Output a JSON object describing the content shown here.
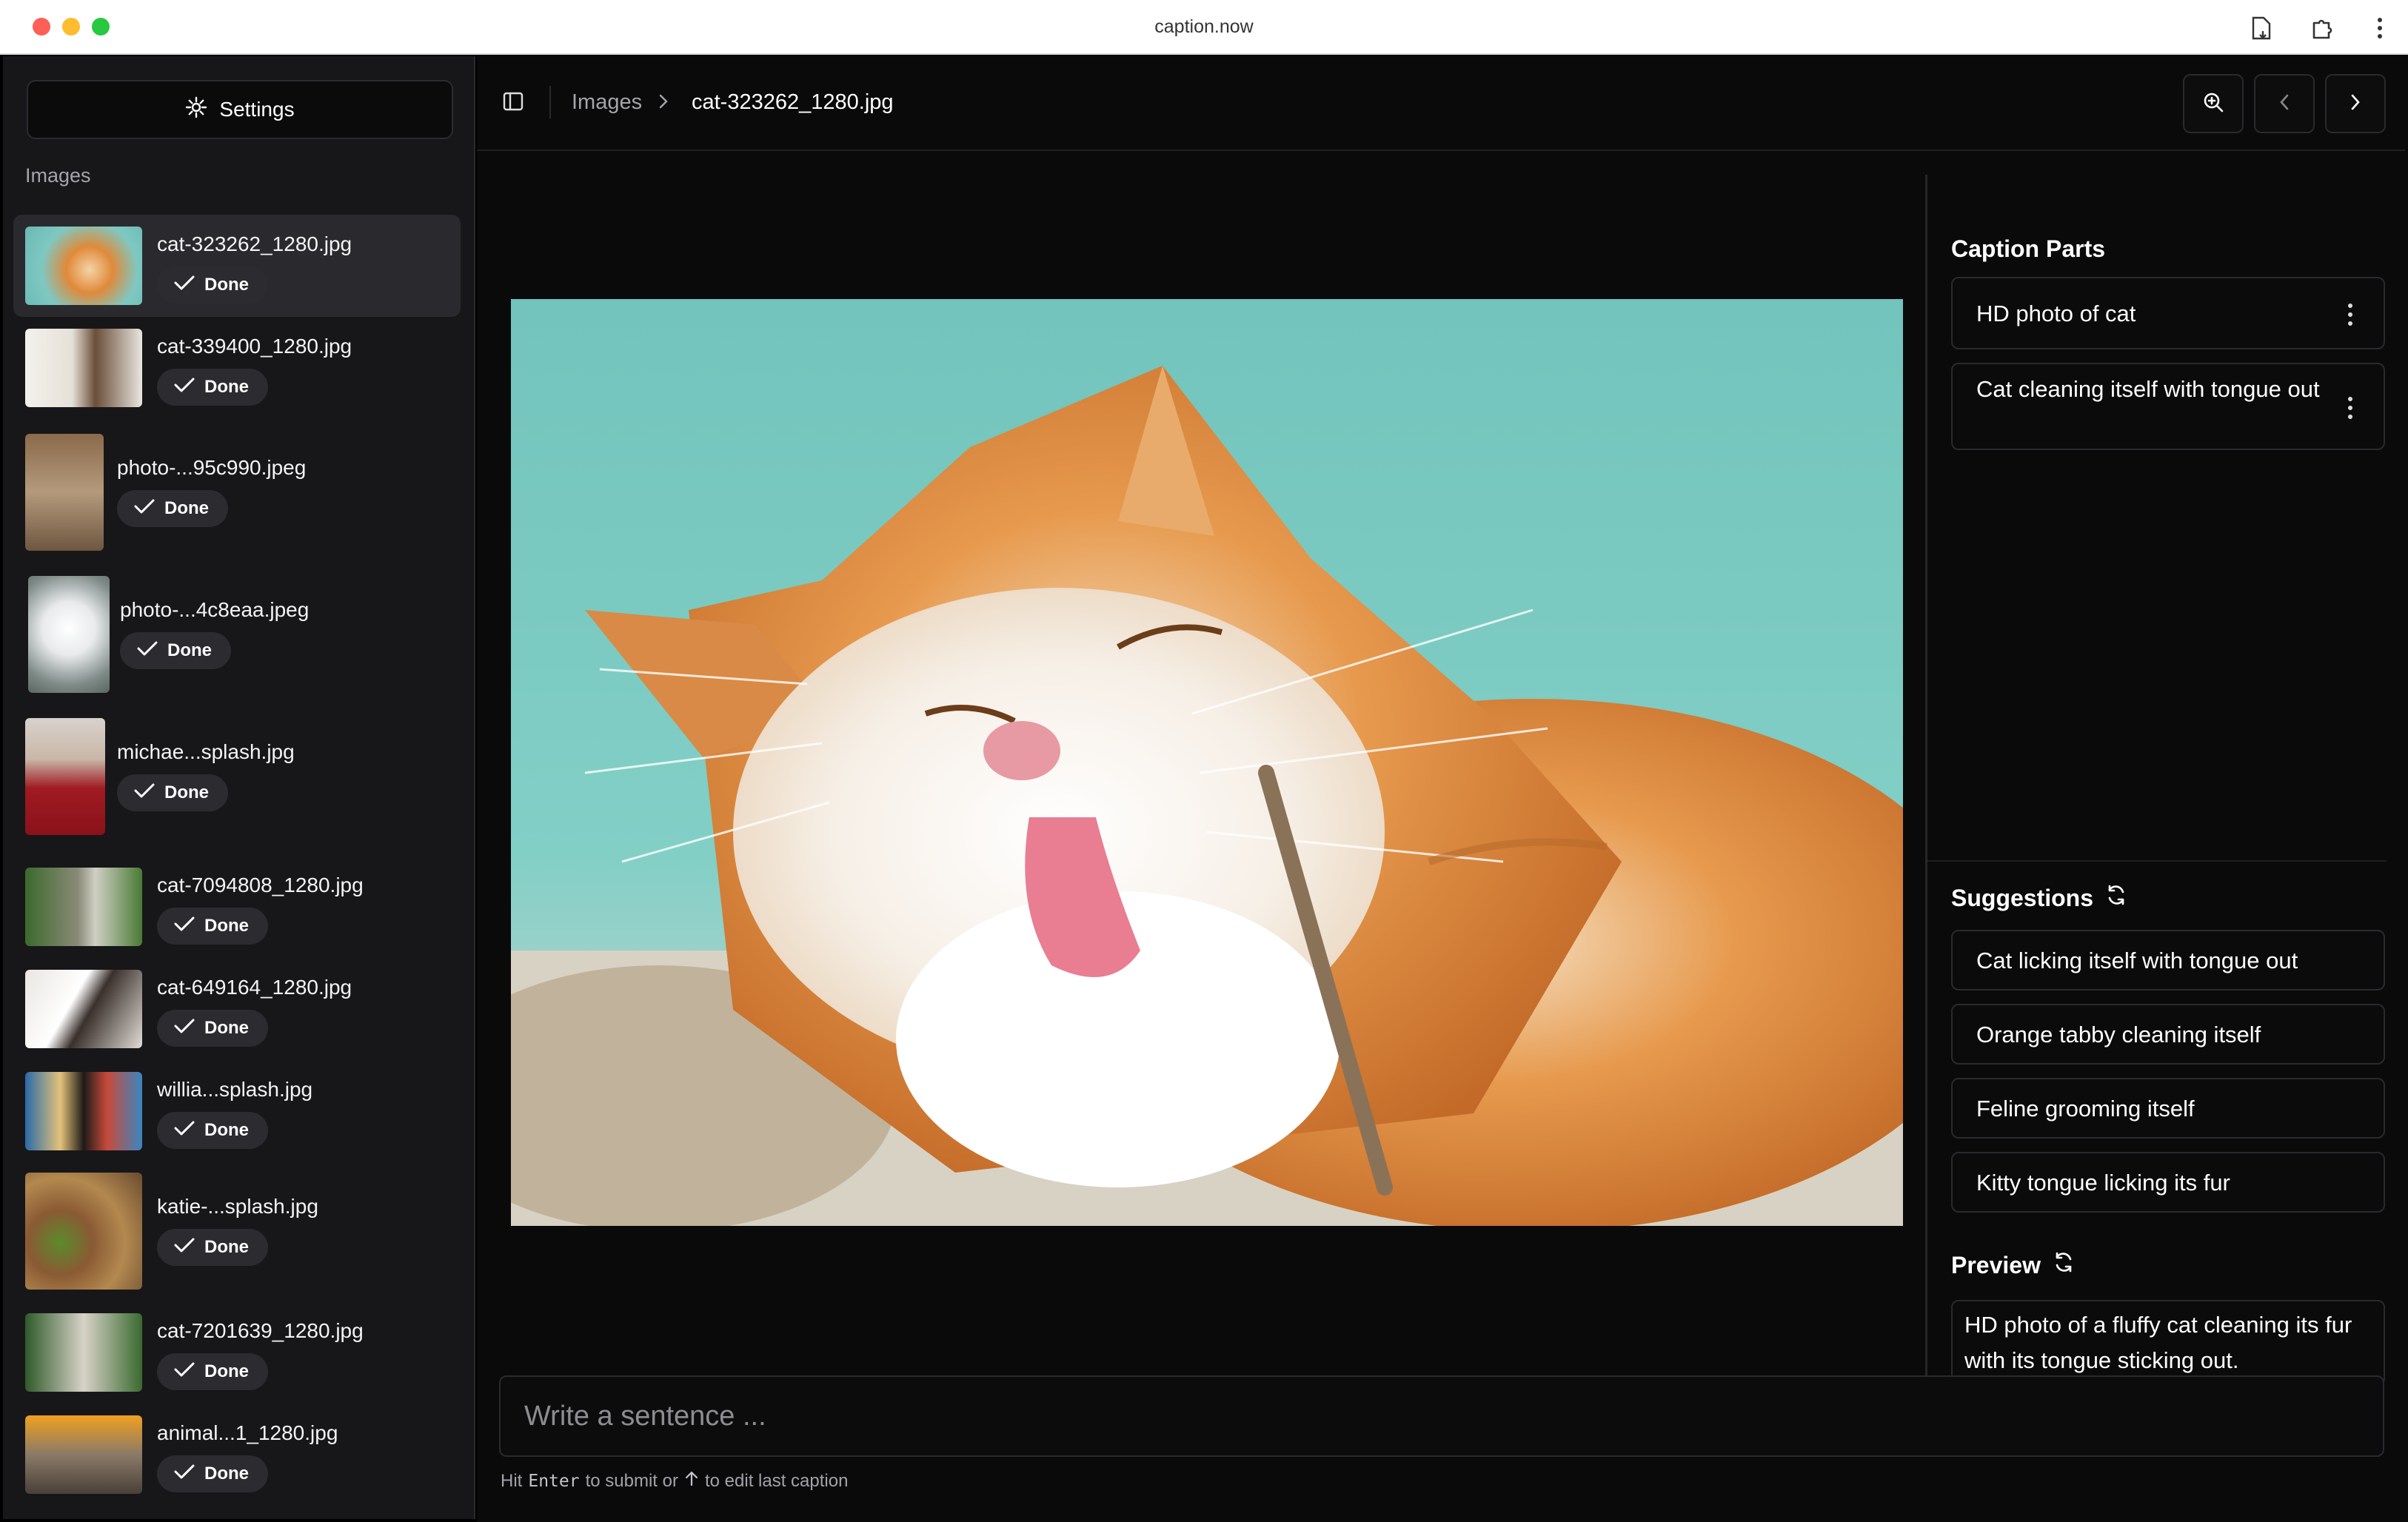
{
  "window": {
    "title": "caption.now"
  },
  "sidebar": {
    "settings_label": "Settings",
    "heading": "Images",
    "items": [
      {
        "name": "cat-323262_1280.jpg",
        "status": "Done",
        "active": true
      },
      {
        "name": "cat-339400_1280.jpg",
        "status": "Done"
      },
      {
        "name": "photo-...95c990.jpeg",
        "status": "Done"
      },
      {
        "name": "photo-...4c8eaa.jpeg",
        "status": "Done"
      },
      {
        "name": "michae...splash.jpg",
        "status": "Done"
      },
      {
        "name": "cat-7094808_1280.jpg",
        "status": "Done"
      },
      {
        "name": "cat-649164_1280.jpg",
        "status": "Done"
      },
      {
        "name": "willia...splash.jpg",
        "status": "Done"
      },
      {
        "name": "katie-...splash.jpg",
        "status": "Done"
      },
      {
        "name": "cat-7201639_1280.jpg",
        "status": "Done"
      },
      {
        "name": "animal...1_1280.jpg",
        "status": "Done"
      }
    ]
  },
  "breadcrumb": {
    "root": "Images",
    "current": "cat-323262_1280.jpg"
  },
  "caption_parts": {
    "title": "Caption Parts",
    "items": [
      "HD photo of cat",
      "Cat cleaning itself with tongue out"
    ]
  },
  "suggestions": {
    "title": "Suggestions",
    "items": [
      "Cat licking itself with tongue out",
      "Orange tabby cleaning itself",
      "Feline grooming itself",
      "Kitty tongue licking its fur"
    ]
  },
  "preview": {
    "title": "Preview",
    "text": "HD photo of a fluffy cat cleaning its fur with its tongue sticking out."
  },
  "composer": {
    "placeholder": "Write a sentence ...",
    "hint_prefix": "Hit",
    "hint_key": "Enter",
    "hint_middle": "to submit or",
    "hint_suffix": "to edit last caption"
  },
  "colors": {
    "accent": "#ffffff",
    "background": "#0a0a0a",
    "sidebar": "#17171a",
    "card_border": "#2a2a2e"
  }
}
